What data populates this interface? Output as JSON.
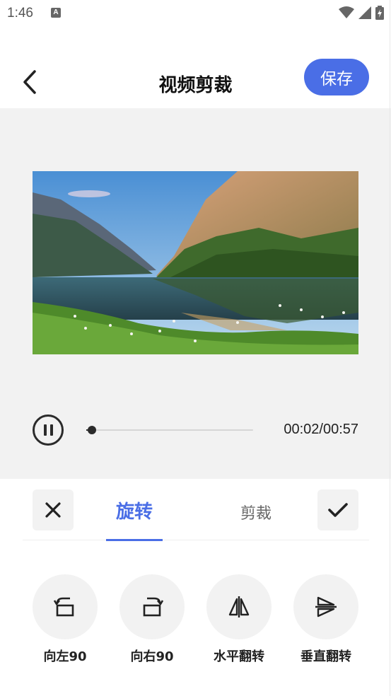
{
  "status_bar": {
    "time": "1:46",
    "notification_letter": "A"
  },
  "header": {
    "title": "视频剪裁",
    "save_label": "保存"
  },
  "player": {
    "current_time": "00:02",
    "total_time": "00:57",
    "time_display": "00:02/00:57",
    "progress": 0.035
  },
  "tabs": [
    {
      "label": "旋转",
      "active": true
    },
    {
      "label": "剪裁",
      "active": false
    }
  ],
  "actions": [
    {
      "label": "向左90",
      "icon": "rotate-left-icon"
    },
    {
      "label": "向右90",
      "icon": "rotate-right-icon"
    },
    {
      "label": "水平翻转",
      "icon": "flip-horizontal-icon"
    },
    {
      "label": "垂直翻转",
      "icon": "flip-vertical-icon"
    }
  ],
  "colors": {
    "accent": "#4a6ee6",
    "panel_bg": "#f2f2f2",
    "text_dark": "#222222"
  }
}
